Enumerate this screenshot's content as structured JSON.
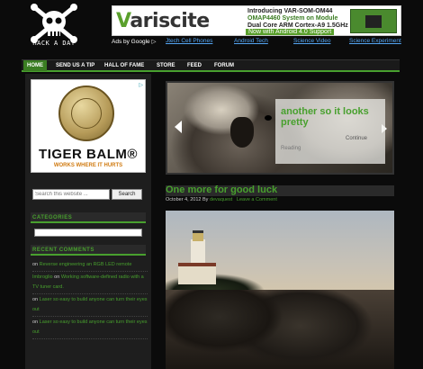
{
  "header": {
    "logo_text": "HACK A DAY"
  },
  "ad_banner": {
    "brand": "Variscite",
    "line1": "Introducing VAR-SOM-OM44",
    "line2": "OMAP4460 System on Module",
    "line3": "Dual Core ARM Cortex-A9 1.5GHz",
    "line4": "Now with Android 4.0 Support"
  },
  "ad_links": {
    "ads_by": "Ads by Google ▷",
    "items": [
      "Jtech Cell Phones",
      "Android Tech",
      "Science Video",
      "Science Experiment"
    ]
  },
  "nav": {
    "items": [
      "HOME",
      "SEND US A TIP",
      "HALL OF FAME",
      "STORE",
      "FEED",
      "FORUM"
    ],
    "active_index": 0
  },
  "sidebar": {
    "ad": {
      "brand": "TIGER BALM®",
      "tagline": "WORKS WHERE IT HURTS",
      "choice": "▷"
    },
    "search": {
      "placeholder": "Search this website ...",
      "button": "Search"
    },
    "categories_heading": "CATEGORIES",
    "recent_comments_heading": "RECENT COMMENTS",
    "recent_comments": [
      {
        "author": "",
        "text": "on ",
        "post": "Reverse engineering an RGB LED remote"
      },
      {
        "author": "Imbroglio",
        "text": " on ",
        "post": "Working software-defined radio with a TV tuner card."
      },
      {
        "author": "",
        "text": "on ",
        "post": "Laser so easy to build anyone can turn their eyes out"
      },
      {
        "author": "",
        "text": "on ",
        "post": "Laser so easy to build anyone can turn their eyes out"
      }
    ]
  },
  "slider": {
    "title": "another so it looks pretty",
    "continue": "Continue",
    "read": "Reading"
  },
  "post": {
    "title": "One more for good luck",
    "date": "October 4, 2012",
    "by": "By",
    "author": "devaquest",
    "comment_link": "Leave a Comment"
  },
  "colors": {
    "accent": "#48a02e",
    "background": "#0b0b0b"
  }
}
